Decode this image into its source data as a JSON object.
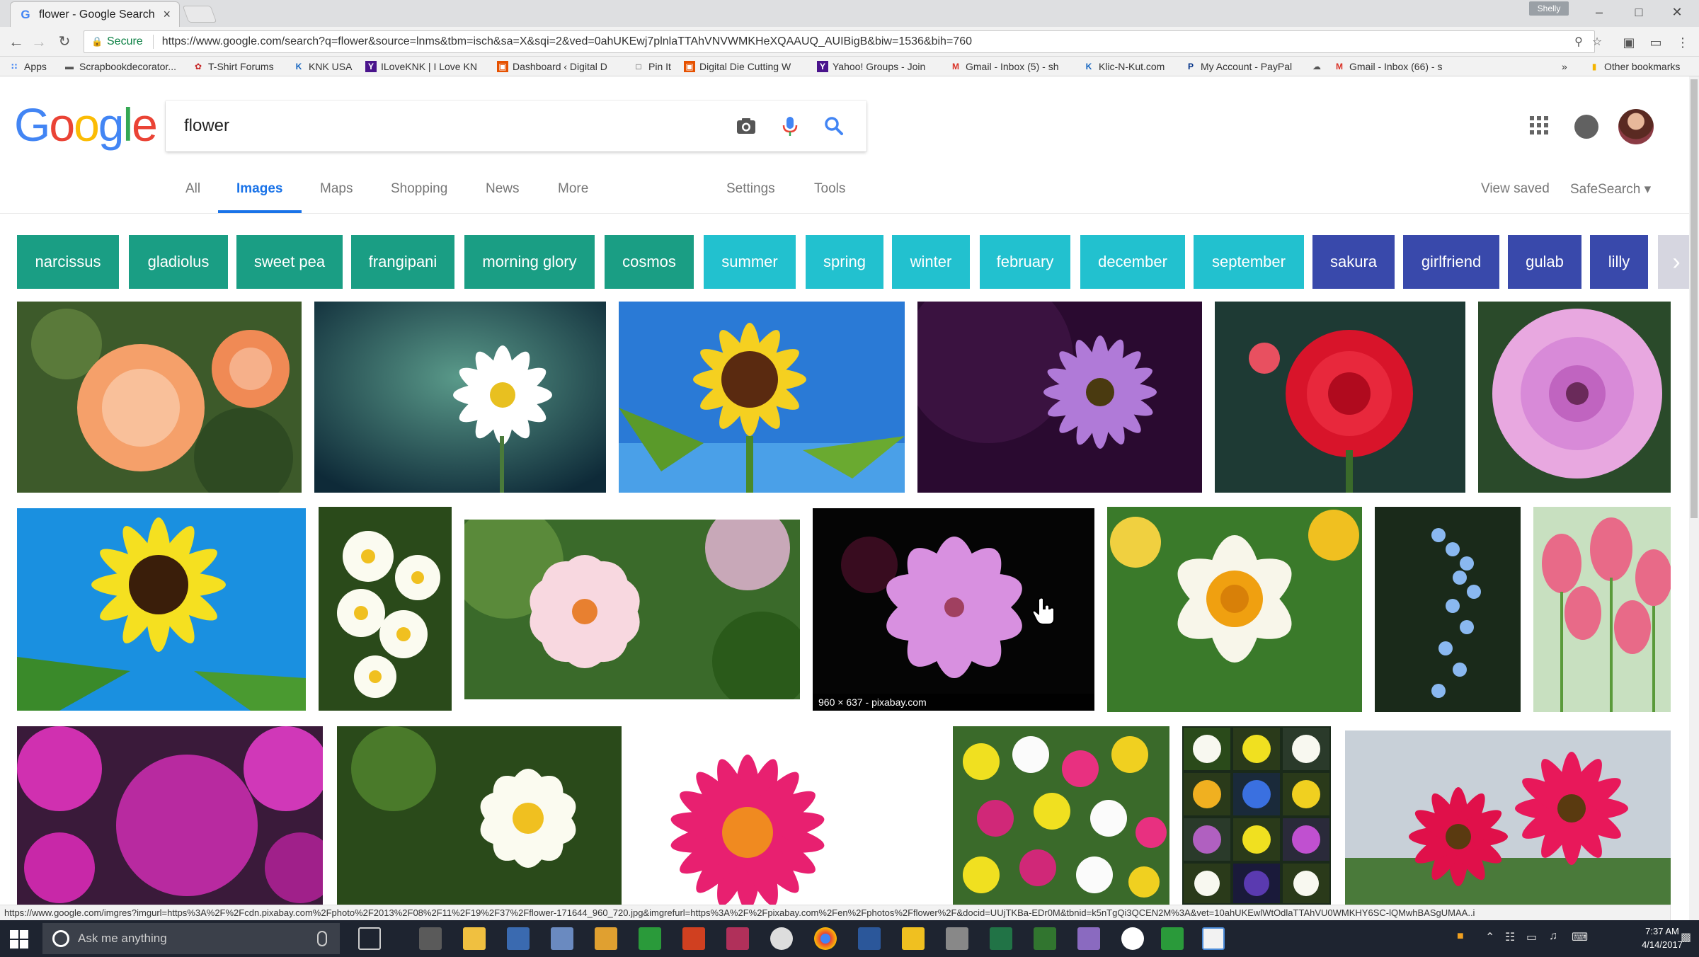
{
  "browser": {
    "tab_title": "flower - Google Search",
    "tab_close": "×",
    "profile_badge": "Shelly",
    "secure_label": "Secure",
    "url": "https://www.google.com/search?q=flower&source=lnms&tbm=isch&sa=X&sqi=2&ved=0ahUKEwj7plnlaTTAhVNVWMKHeXQAAUQ_AUIBigB&biw=1536&bih=760",
    "bookmarks": [
      {
        "label": "Apps",
        "color": "#4285f4",
        "icon": "apps-grid-icon"
      },
      {
        "label": "Scrapbookdecorator...",
        "color": "#555555",
        "icon": "scrapbook-icon"
      },
      {
        "label": "T-Shirt Forums",
        "color": "#c62828",
        "icon": "tshirt-icon"
      },
      {
        "label": "KNK USA",
        "color": "#1565c0",
        "icon": "knk-icon"
      },
      {
        "label": "ILoveKNK | I Love KN",
        "color": "#4a148c",
        "icon": "yahoo-icon"
      },
      {
        "label": "Dashboard ‹ Digital D",
        "color": "#e65100",
        "icon": "dashboard-icon"
      },
      {
        "label": "Pin It",
        "color": "#333333",
        "icon": "page-icon"
      },
      {
        "label": "Digital Die Cutting W",
        "color": "#e65100",
        "icon": "dashboard-icon"
      },
      {
        "label": "Yahoo! Groups - Join",
        "color": "#4a148c",
        "icon": "yahoo-icon"
      },
      {
        "label": "Gmail - Inbox (5) - sh",
        "color": "#d93025",
        "icon": "gmail-icon"
      },
      {
        "label": "Klic-N-Kut.com",
        "color": "#1565c0",
        "icon": "knk-icon"
      },
      {
        "label": "My Account - PayPal",
        "color": "#003087",
        "icon": "paypal-icon"
      },
      {
        "label": "",
        "color": "#555555",
        "icon": "cloud-icon"
      },
      {
        "label": "Gmail - Inbox (66) - s",
        "color": "#d93025",
        "icon": "gmail-icon"
      },
      {
        "label": "»",
        "color": "#555555",
        "icon": ""
      },
      {
        "label": "Other bookmarks",
        "color": "#f4b400",
        "icon": "folder-icon"
      }
    ]
  },
  "google": {
    "logo_letters": [
      "G",
      "o",
      "o",
      "g",
      "l",
      "e"
    ],
    "logo_colors": [
      "#4285f4",
      "#ea4335",
      "#fbbc05",
      "#4285f4",
      "#34a853",
      "#ea4335"
    ],
    "query": "flower",
    "nav": {
      "items": [
        "All",
        "Images",
        "Maps",
        "Shopping",
        "News",
        "More"
      ],
      "active": "Images",
      "settings": "Settings",
      "tools": "Tools",
      "view_saved": "View saved",
      "safesearch": "SafeSearch ▾"
    },
    "chips": [
      {
        "label": "narcissus",
        "color": "#1a9e84"
      },
      {
        "label": "gladiolus",
        "color": "#1a9e84"
      },
      {
        "label": "sweet pea",
        "color": "#1a9e84"
      },
      {
        "label": "frangipani",
        "color": "#1a9e84"
      },
      {
        "label": "morning glory",
        "color": "#1a9e84"
      },
      {
        "label": "cosmos",
        "color": "#1a9e84"
      },
      {
        "label": "summer",
        "color": "#22c1cf"
      },
      {
        "label": "spring",
        "color": "#22c1cf"
      },
      {
        "label": "winter",
        "color": "#22c1cf"
      },
      {
        "label": "february",
        "color": "#22c1cf"
      },
      {
        "label": "december",
        "color": "#22c1cf"
      },
      {
        "label": "september",
        "color": "#22c1cf"
      },
      {
        "label": "sakura",
        "color": "#3949ab"
      },
      {
        "label": "girlfriend",
        "color": "#3949ab"
      },
      {
        "label": "gulab",
        "color": "#3949ab"
      },
      {
        "label": "lilly",
        "color": "#3949ab"
      }
    ],
    "chip_next": "›",
    "hover_caption": "960 × 637 - pixabay.com",
    "status_url": "https://www.google.com/imgres?imgurl=https%3A%2F%2Fcdn.pixabay.com%2Fphoto%2F2013%2F08%2F11%2F19%2F37%2Fflower-171644_960_720.jpg&imgrefurl=https%3A%2F%2Fpixabay.com%2Fen%2Fphotos%2Fflower%2F&docid=UUjTKBa-EDr0M&tbnid=k5nTgQi3QCEN2M%3A&vet=10ahUKEwlWtOdlaTTAhVU0WMKHY6SC-lQMwhBASgUMAA..i"
  },
  "taskbar": {
    "search_placeholder": "Ask me anything",
    "time": "7:37 AM",
    "date": "4/14/2017"
  }
}
